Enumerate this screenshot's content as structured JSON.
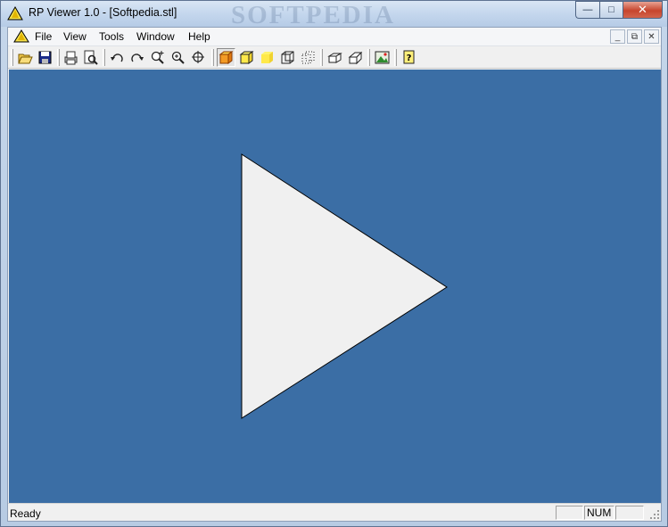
{
  "window": {
    "title": "RP Viewer 1.0 - [Softpedia.stl]",
    "watermark": "SOFTPEDIA",
    "controls": {
      "minimize": "—",
      "maximize": "□",
      "close": "✕"
    }
  },
  "menubar": {
    "items": [
      "File",
      "View",
      "Tools",
      "Window",
      "Help"
    ],
    "mdi": {
      "minimize": "_",
      "restore": "⧉",
      "close": "✕"
    }
  },
  "toolbar": {
    "buttons": [
      {
        "icon": "open-icon",
        "pressed": false
      },
      {
        "icon": "save-icon",
        "pressed": false
      },
      {
        "icon": "print-icon",
        "pressed": false
      },
      {
        "icon": "print-preview-icon",
        "pressed": false
      },
      {
        "icon": "rotate-left-icon",
        "pressed": false
      },
      {
        "icon": "rotate-right-icon",
        "pressed": false
      },
      {
        "icon": "zoom-in-icon",
        "pressed": false
      },
      {
        "icon": "zoom-window-icon",
        "pressed": false
      },
      {
        "icon": "zoom-fit-icon",
        "pressed": false
      },
      {
        "icon": "shaded-view-icon",
        "pressed": true
      },
      {
        "icon": "shaded-edges-icon",
        "pressed": false
      },
      {
        "icon": "flat-view-icon",
        "pressed": false
      },
      {
        "icon": "wireframe-icon",
        "pressed": false
      },
      {
        "icon": "points-view-icon",
        "pressed": false
      },
      {
        "icon": "iso-view-icon",
        "pressed": false
      },
      {
        "icon": "perspective-view-icon",
        "pressed": false
      },
      {
        "icon": "export-image-icon",
        "pressed": false
      },
      {
        "icon": "help-icon",
        "pressed": false
      }
    ]
  },
  "viewport": {
    "background": "#3b6ea5",
    "model_fill": "#f0f0f0"
  },
  "statusbar": {
    "text": "Ready",
    "panes": [
      "",
      "NUM",
      ""
    ]
  }
}
